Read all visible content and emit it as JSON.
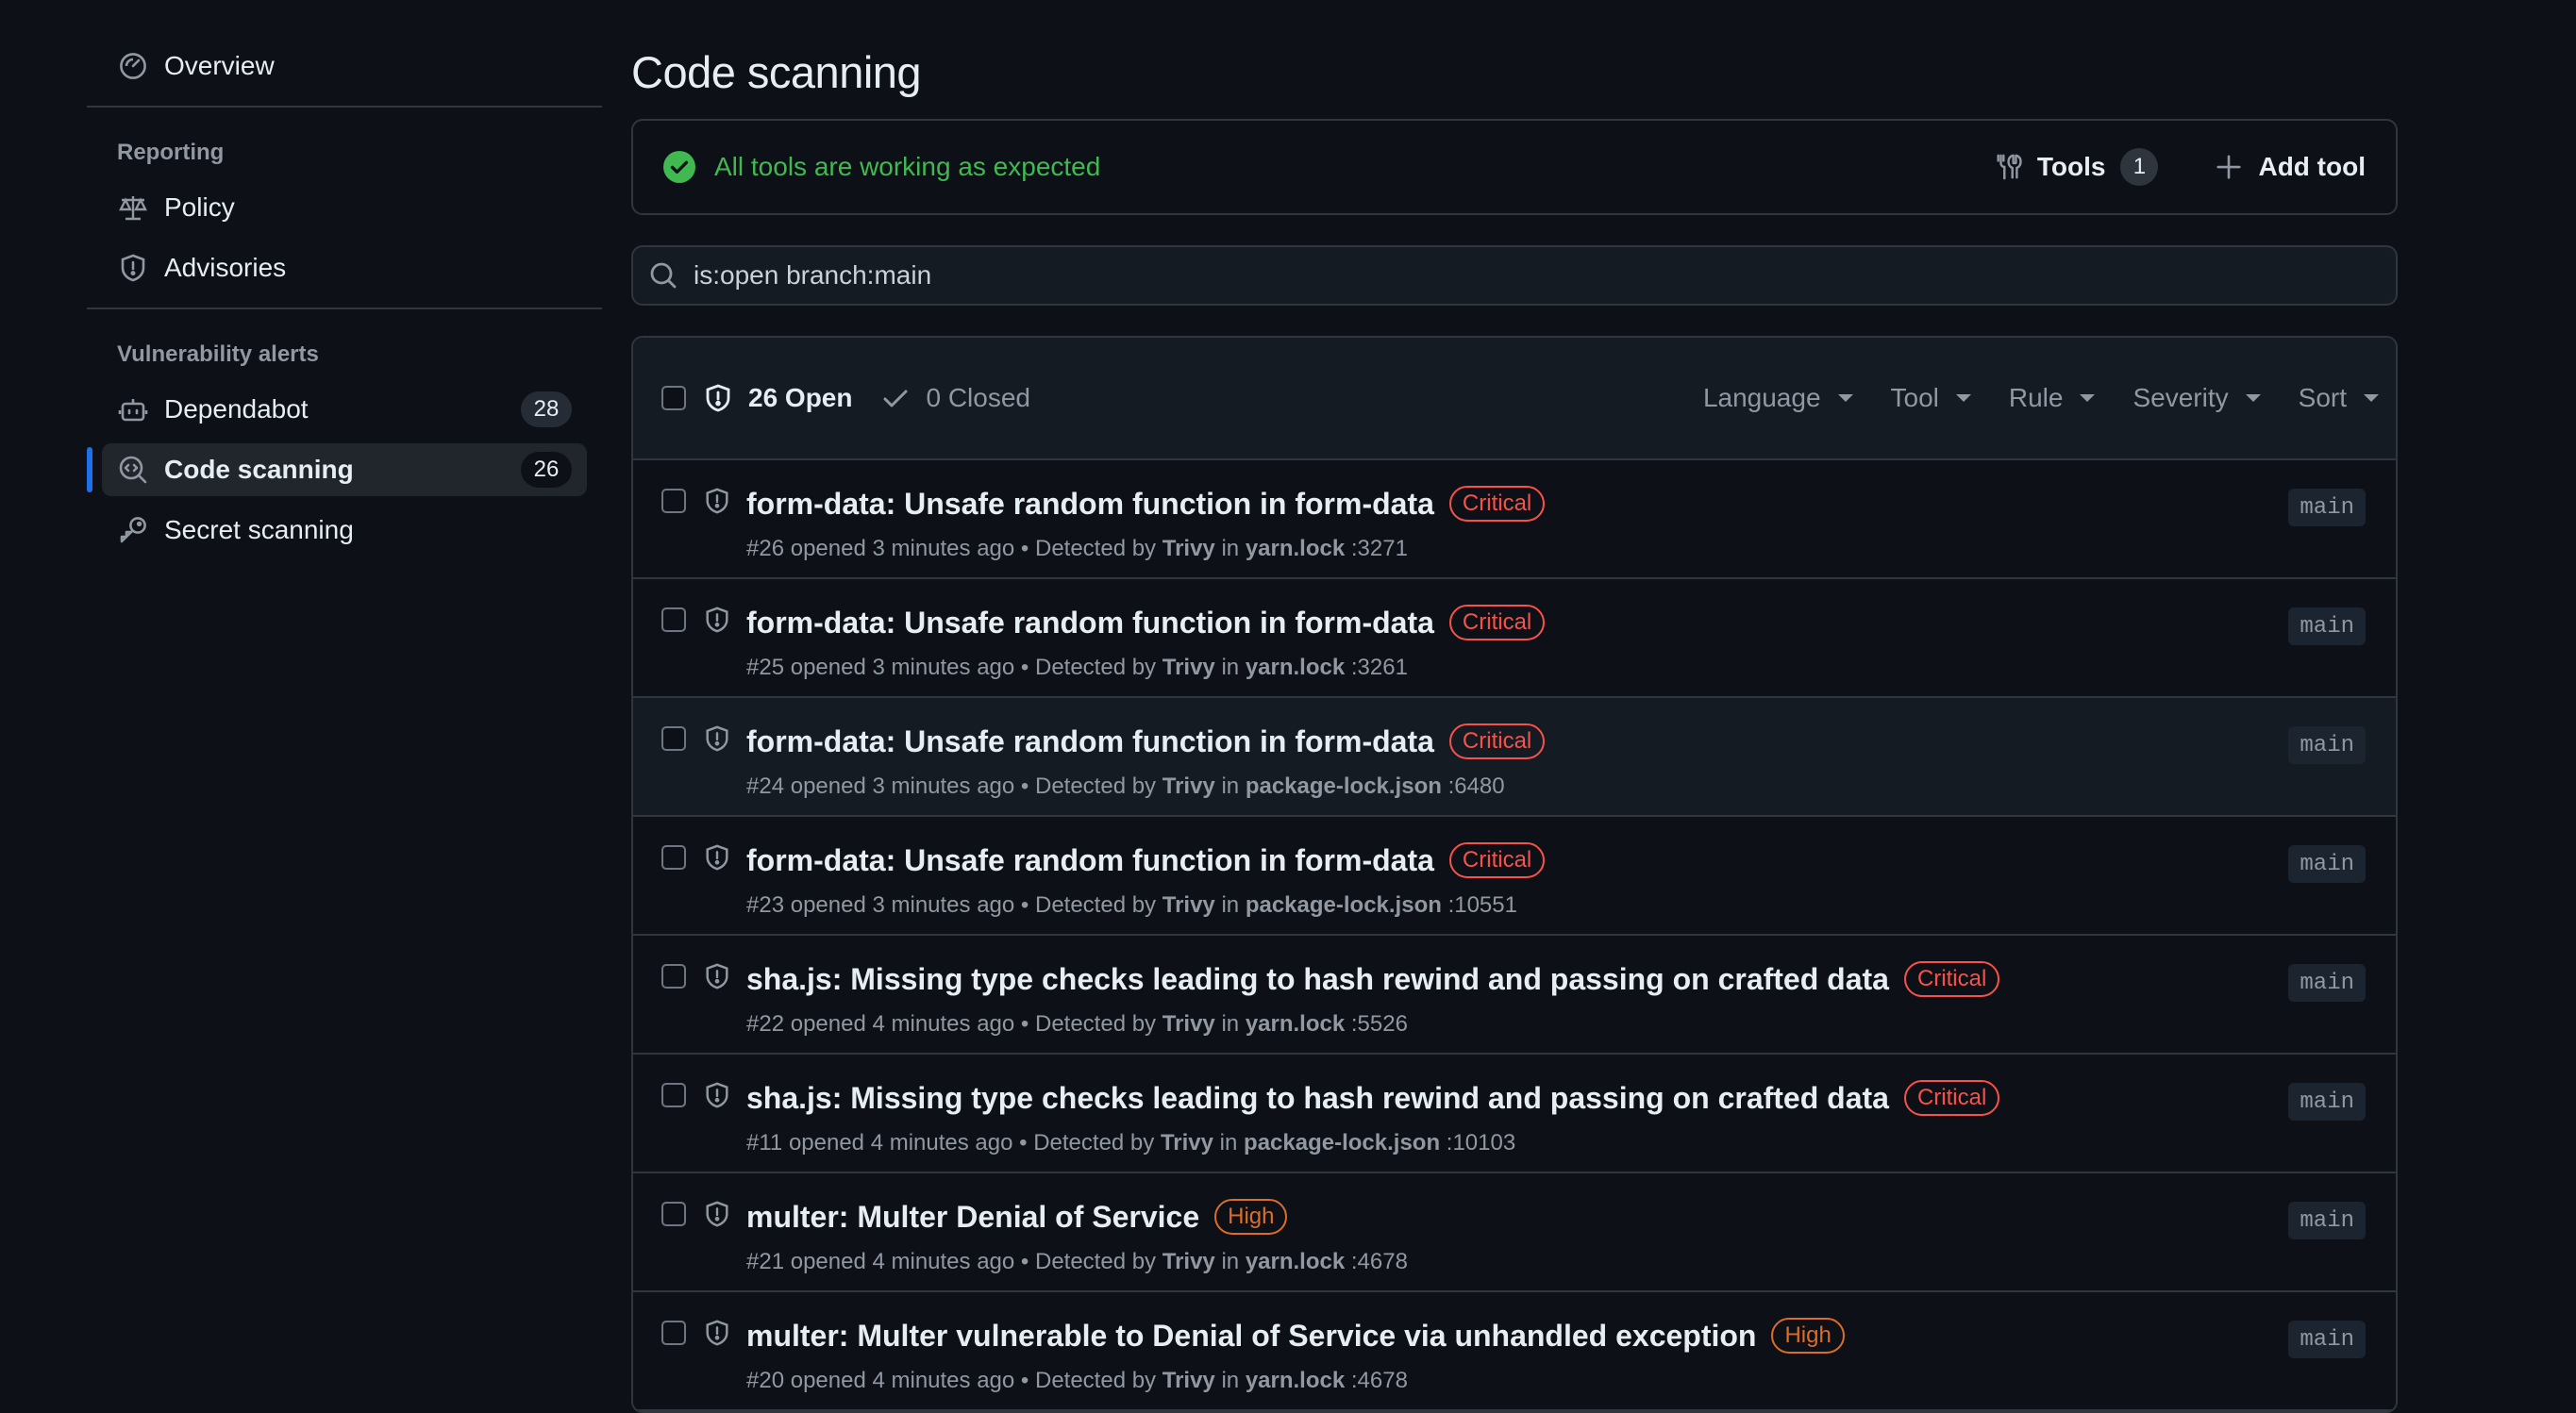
{
  "sidebar": {
    "overview": "Overview",
    "reporting_label": "Reporting",
    "policy": "Policy",
    "advisories": "Advisories",
    "vuln_label": "Vulnerability alerts",
    "dependabot": "Dependabot",
    "dependabot_count": "28",
    "code_scanning": "Code scanning",
    "code_scanning_count": "26",
    "secret_scanning": "Secret scanning"
  },
  "page": {
    "title": "Code scanning",
    "status": "All tools are working as expected",
    "tools_label": "Tools",
    "tools_count": "1",
    "add_tool": "Add tool",
    "search_value": "is:open branch:main"
  },
  "table": {
    "open": "26 Open",
    "closed": "0 Closed",
    "filters": [
      "Language",
      "Tool",
      "Rule",
      "Severity",
      "Sort"
    ],
    "rows": [
      {
        "title": "form-data: Unsafe random function in form-data",
        "severity": "Critical",
        "sevclass": "critical",
        "num": "#26",
        "opened": "opened 3 minutes ago",
        "dot": "•",
        "detected": "Detected by",
        "tool": "Trivy",
        "in": "in",
        "file": "yarn.lock",
        "line": ":3271",
        "branch": "main"
      },
      {
        "title": "form-data: Unsafe random function in form-data",
        "severity": "Critical",
        "sevclass": "critical",
        "num": "#25",
        "opened": "opened 3 minutes ago",
        "dot": "•",
        "detected": "Detected by",
        "tool": "Trivy",
        "in": "in",
        "file": "yarn.lock",
        "line": ":3261",
        "branch": "main"
      },
      {
        "title": "form-data: Unsafe random function in form-data",
        "severity": "Critical",
        "sevclass": "critical",
        "num": "#24",
        "opened": "opened 3 minutes ago",
        "dot": "•",
        "detected": "Detected by",
        "tool": "Trivy",
        "in": "in",
        "file": "package-lock.json",
        "line": ":6480",
        "branch": "main"
      },
      {
        "title": "form-data: Unsafe random function in form-data",
        "severity": "Critical",
        "sevclass": "critical",
        "num": "#23",
        "opened": "opened 3 minutes ago",
        "dot": "•",
        "detected": "Detected by",
        "tool": "Trivy",
        "in": "in",
        "file": "package-lock.json",
        "line": ":10551",
        "branch": "main"
      },
      {
        "title": "sha.js: Missing type checks leading to hash rewind and passing on crafted data",
        "severity": "Critical",
        "sevclass": "critical",
        "num": "#22",
        "opened": "opened 4 minutes ago",
        "dot": "•",
        "detected": "Detected by",
        "tool": "Trivy",
        "in": "in",
        "file": "yarn.lock",
        "line": ":5526",
        "branch": "main"
      },
      {
        "title": "sha.js: Missing type checks leading to hash rewind and passing on crafted data",
        "severity": "Critical",
        "sevclass": "critical",
        "num": "#11",
        "opened": "opened 4 minutes ago",
        "dot": "•",
        "detected": "Detected by",
        "tool": "Trivy",
        "in": "in",
        "file": "package-lock.json",
        "line": ":10103",
        "branch": "main"
      },
      {
        "title": "multer: Multer Denial of Service",
        "severity": "High",
        "sevclass": "high",
        "num": "#21",
        "opened": "opened 4 minutes ago",
        "dot": "•",
        "detected": "Detected by",
        "tool": "Trivy",
        "in": "in",
        "file": "yarn.lock",
        "line": ":4678",
        "branch": "main"
      },
      {
        "title": "multer: Multer vulnerable to Denial of Service via unhandled exception",
        "severity": "High",
        "sevclass": "high",
        "num": "#20",
        "opened": "opened 4 minutes ago",
        "dot": "•",
        "detected": "Detected by",
        "tool": "Trivy",
        "in": "in",
        "file": "yarn.lock",
        "line": ":4678",
        "branch": "main"
      }
    ]
  },
  "colors": {
    "background": "#0d1117",
    "critical": "#f85149",
    "high": "#db6d28",
    "success": "#3fb950",
    "accent": "#1f6feb"
  }
}
